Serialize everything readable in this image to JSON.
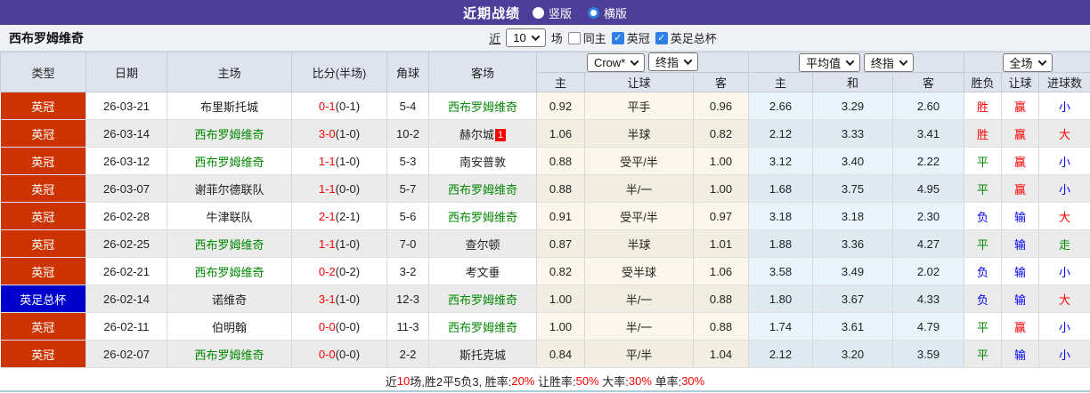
{
  "topbar": {
    "title": "近期战绩",
    "radio_vertical": "竖版",
    "radio_horizontal": "横版"
  },
  "filter": {
    "team": "西布罗姆维奇",
    "near_label": "近",
    "count": "10",
    "games_label": "场",
    "same_home_label": "同主",
    "league_checkbox_label": "英冠",
    "cup_checkbox_label": "英足总杯"
  },
  "controls": {
    "bookmaker": "Crow*",
    "odds_type": "终指",
    "avg_label": "平均值",
    "avg_type": "终指",
    "scope": "全场"
  },
  "colors": {
    "red": "#ff0000",
    "green": "#008800",
    "blue": "#0000ff",
    "league_red": "#cc3300",
    "league_blue": "#0000cc"
  },
  "table": {
    "headers_left": [
      "类型",
      "日期",
      "主场",
      "比分(半场)",
      "角球",
      "客场"
    ],
    "headers_sub": [
      "主",
      "让球",
      "客",
      "主",
      "和",
      "客",
      "胜负",
      "让球",
      "进球数"
    ],
    "rows": [
      {
        "league": "英冠",
        "league_color": "red",
        "date": "26-03-21",
        "home": "布里斯托城",
        "home_green": false,
        "score": "0-1",
        "half": "(0-1)",
        "corner": "5-4",
        "away": "西布罗姆维奇",
        "away_green": true,
        "away_badge": "",
        "o_home": "0.92",
        "handicap": "平手",
        "o_away": "0.96",
        "avg_home": "2.66",
        "avg_draw": "3.29",
        "avg_away": "2.60",
        "result": "胜",
        "hcap_result": "赢",
        "goals": "小"
      },
      {
        "league": "英冠",
        "league_color": "red",
        "date": "26-03-14",
        "home": "西布罗姆维奇",
        "home_green": true,
        "score": "3-0",
        "half": "(1-0)",
        "corner": "10-2",
        "away": "赫尔城",
        "away_green": false,
        "away_badge": "1",
        "o_home": "1.06",
        "handicap": "半球",
        "o_away": "0.82",
        "avg_home": "2.12",
        "avg_draw": "3.33",
        "avg_away": "3.41",
        "result": "胜",
        "hcap_result": "赢",
        "goals": "大"
      },
      {
        "league": "英冠",
        "league_color": "red",
        "date": "26-03-12",
        "home": "西布罗姆维奇",
        "home_green": true,
        "score": "1-1",
        "half": "(1-0)",
        "corner": "5-3",
        "away": "南安普敦",
        "away_green": false,
        "away_badge": "",
        "o_home": "0.88",
        "handicap": "受平/半",
        "o_away": "1.00",
        "avg_home": "3.12",
        "avg_draw": "3.40",
        "avg_away": "2.22",
        "result": "平",
        "hcap_result": "赢",
        "goals": "小"
      },
      {
        "league": "英冠",
        "league_color": "red",
        "date": "26-03-07",
        "home": "谢菲尔德联队",
        "home_green": false,
        "score": "1-1",
        "half": "(0-0)",
        "corner": "5-7",
        "away": "西布罗姆维奇",
        "away_green": true,
        "away_badge": "",
        "o_home": "0.88",
        "handicap": "半/一",
        "o_away": "1.00",
        "avg_home": "1.68",
        "avg_draw": "3.75",
        "avg_away": "4.95",
        "result": "平",
        "hcap_result": "赢",
        "goals": "小"
      },
      {
        "league": "英冠",
        "league_color": "red",
        "date": "26-02-28",
        "home": "牛津联队",
        "home_green": false,
        "score": "2-1",
        "half": "(2-1)",
        "corner": "5-6",
        "away": "西布罗姆维奇",
        "away_green": true,
        "away_badge": "",
        "o_home": "0.91",
        "handicap": "受平/半",
        "o_away": "0.97",
        "avg_home": "3.18",
        "avg_draw": "3.18",
        "avg_away": "2.30",
        "result": "负",
        "hcap_result": "输",
        "goals": "大"
      },
      {
        "league": "英冠",
        "league_color": "red",
        "date": "26-02-25",
        "home": "西布罗姆维奇",
        "home_green": true,
        "score": "1-1",
        "half": "(1-0)",
        "corner": "7-0",
        "away": "查尔顿",
        "away_green": false,
        "away_badge": "",
        "o_home": "0.87",
        "handicap": "半球",
        "o_away": "1.01",
        "avg_home": "1.88",
        "avg_draw": "3.36",
        "avg_away": "4.27",
        "result": "平",
        "hcap_result": "输",
        "goals": "走"
      },
      {
        "league": "英冠",
        "league_color": "red",
        "date": "26-02-21",
        "home": "西布罗姆维奇",
        "home_green": true,
        "score": "0-2",
        "half": "(0-2)",
        "corner": "3-2",
        "away": "考文垂",
        "away_green": false,
        "away_badge": "",
        "o_home": "0.82",
        "handicap": "受半球",
        "o_away": "1.06",
        "avg_home": "3.58",
        "avg_draw": "3.49",
        "avg_away": "2.02",
        "result": "负",
        "hcap_result": "输",
        "goals": "小"
      },
      {
        "league": "英足总杯",
        "league_color": "blue",
        "date": "26-02-14",
        "home": "诺维奇",
        "home_green": false,
        "score": "3-1",
        "half": "(1-0)",
        "corner": "12-3",
        "away": "西布罗姆维奇",
        "away_green": true,
        "away_badge": "",
        "o_home": "1.00",
        "handicap": "半/一",
        "o_away": "0.88",
        "avg_home": "1.80",
        "avg_draw": "3.67",
        "avg_away": "4.33",
        "result": "负",
        "hcap_result": "输",
        "goals": "大"
      },
      {
        "league": "英冠",
        "league_color": "red",
        "date": "26-02-11",
        "home": "伯明翰",
        "home_green": false,
        "score": "0-0",
        "half": "(0-0)",
        "corner": "11-3",
        "away": "西布罗姆维奇",
        "away_green": true,
        "away_badge": "",
        "o_home": "1.00",
        "handicap": "半/一",
        "o_away": "0.88",
        "avg_home": "1.74",
        "avg_draw": "3.61",
        "avg_away": "4.79",
        "result": "平",
        "hcap_result": "赢",
        "goals": "小"
      },
      {
        "league": "英冠",
        "league_color": "red",
        "date": "26-02-07",
        "home": "西布罗姆维奇",
        "home_green": true,
        "score": "0-0",
        "half": "(0-0)",
        "corner": "2-2",
        "away": "斯托克城",
        "away_green": false,
        "away_badge": "",
        "o_home": "0.84",
        "handicap": "平/半",
        "o_away": "1.04",
        "avg_home": "2.12",
        "avg_draw": "3.20",
        "avg_away": "3.59",
        "result": "平",
        "hcap_result": "输",
        "goals": "小"
      }
    ]
  },
  "footer": {
    "p1": "近",
    "n1": "10",
    "p2": "场,胜2平5负3, 胜率:",
    "n2": "20%",
    "p3": " 让胜率:",
    "n3": "50%",
    "p4": " 大率:",
    "n4": "30%",
    "p5": " 单率:",
    "n5": "30%"
  }
}
